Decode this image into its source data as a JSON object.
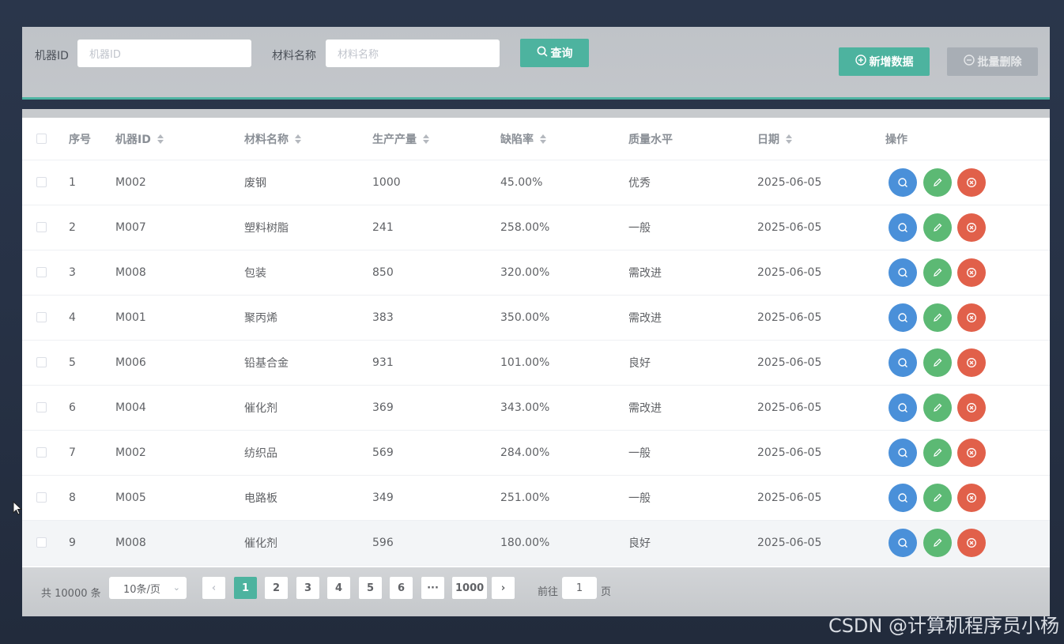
{
  "search": {
    "machine_id_label": "机器ID",
    "machine_id_placeholder": "机器ID",
    "material_label": "材料名称",
    "material_placeholder": "材料名称",
    "query_button": "查询",
    "add_button": "新增数据",
    "batch_delete_button": "批量删除"
  },
  "table": {
    "columns": [
      "序号",
      "机器ID",
      "材料名称",
      "生产产量",
      "缺陷率",
      "质量水平",
      "日期",
      "操作"
    ],
    "rows": [
      {
        "no": "1",
        "machine_id": "M002",
        "material": "废钢",
        "output": "1000",
        "defect_rate": "45.00%",
        "quality": "优秀",
        "date": "2025-06-05"
      },
      {
        "no": "2",
        "machine_id": "M007",
        "material": "塑料树脂",
        "output": "241",
        "defect_rate": "258.00%",
        "quality": "一般",
        "date": "2025-06-05"
      },
      {
        "no": "3",
        "machine_id": "M008",
        "material": "包装",
        "output": "850",
        "defect_rate": "320.00%",
        "quality": "需改进",
        "date": "2025-06-05"
      },
      {
        "no": "4",
        "machine_id": "M001",
        "material": "聚丙烯",
        "output": "383",
        "defect_rate": "350.00%",
        "quality": "需改进",
        "date": "2025-06-05"
      },
      {
        "no": "5",
        "machine_id": "M006",
        "material": "铅基合金",
        "output": "931",
        "defect_rate": "101.00%",
        "quality": "良好",
        "date": "2025-06-05"
      },
      {
        "no": "6",
        "machine_id": "M004",
        "material": "催化剂",
        "output": "369",
        "defect_rate": "343.00%",
        "quality": "需改进",
        "date": "2025-06-05"
      },
      {
        "no": "7",
        "machine_id": "M002",
        "material": "纺织品",
        "output": "569",
        "defect_rate": "284.00%",
        "quality": "一般",
        "date": "2025-06-05"
      },
      {
        "no": "8",
        "machine_id": "M005",
        "material": "电路板",
        "output": "349",
        "defect_rate": "251.00%",
        "quality": "一般",
        "date": "2025-06-05"
      },
      {
        "no": "9",
        "machine_id": "M008",
        "material": "催化剂",
        "output": "596",
        "defect_rate": "180.00%",
        "quality": "良好",
        "date": "2025-06-05"
      }
    ]
  },
  "pagination": {
    "total": "共 10000 条",
    "page_size": "10条/页",
    "pages": [
      "1",
      "2",
      "3",
      "4",
      "5",
      "6",
      "···",
      "1000"
    ],
    "current": "1",
    "goto_label": "前往",
    "goto_value": "1",
    "goto_suffix": "页"
  },
  "watermark": "CSDN @计算机程序员小杨",
  "colors": {
    "accent": "#4db39f",
    "view": "#4a90d9",
    "edit": "#5cb974",
    "remove": "#e1604a"
  }
}
